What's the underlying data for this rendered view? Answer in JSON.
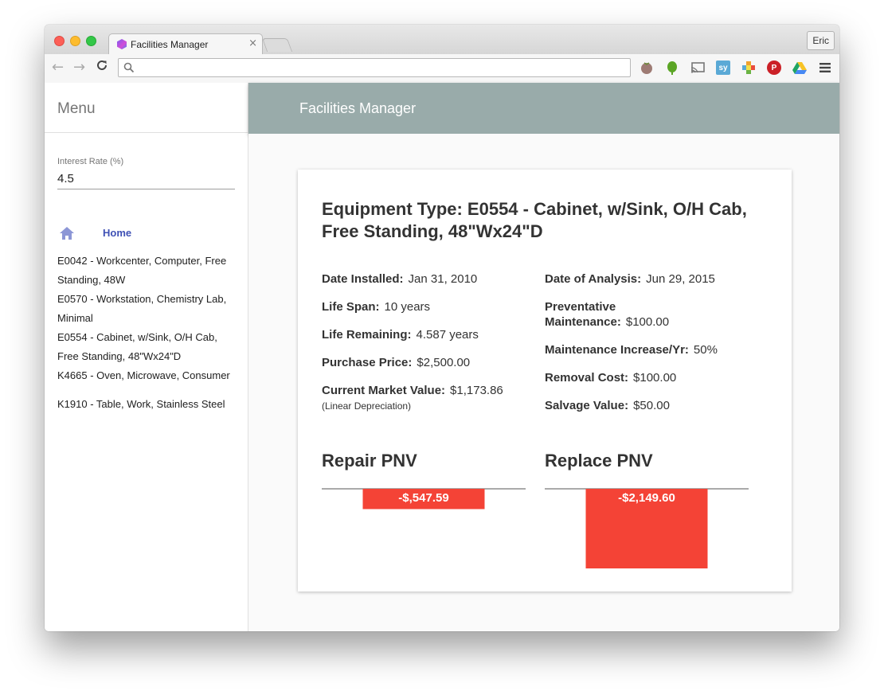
{
  "browser": {
    "tab_title": "Facilities Manager",
    "tab_close": "×",
    "profile": "Eric",
    "url": "",
    "back": "←",
    "forward": "→",
    "reload": "C"
  },
  "extensions": [
    {
      "name": "tomato-icon",
      "color": "#9e7b74",
      "label": ""
    },
    {
      "name": "evernote-icon",
      "color": "#5ba525",
      "label": ""
    },
    {
      "name": "cast-icon",
      "color": "#777777",
      "label": ""
    },
    {
      "name": "sy-icon",
      "color": "#5aa9d6",
      "label": "sy"
    },
    {
      "name": "puzzle-icon",
      "color": "#f0a22e",
      "label": ""
    },
    {
      "name": "pinterest-icon",
      "color": "#cb2027",
      "label": "P"
    },
    {
      "name": "drive-icon",
      "color": "#2fa84f",
      "label": ""
    }
  ],
  "sidebar": {
    "menu_title": "Menu",
    "interest_label": "Interest Rate (%)",
    "interest_value": "4.5",
    "home_label": "Home",
    "items": [
      "E0042 - Workcenter, Computer, Free Standing, 48W",
      "E0570 - Workstation, Chemistry Lab, Minimal",
      "E0554 - Cabinet, w/Sink, O/H Cab, Free Standing, 48\"Wx24\"D",
      "K4665 - Oven, Microwave, Consumer",
      "K1910 - Table, Work, Stainless Steel"
    ]
  },
  "header": {
    "title": "Facilities Manager"
  },
  "card": {
    "title": "Equipment Type: E0554 - Cabinet, w/Sink, O/H Cab, Free Standing, 48\"Wx24\"D",
    "left": {
      "date_installed_label": "Date Installed:",
      "date_installed": "Jan 31, 2010",
      "life_span_label": "Life Span:",
      "life_span": "10 years",
      "life_remaining_label": "Life Remaining:",
      "life_remaining": "4.587 years",
      "purchase_price_label": "Purchase Price:",
      "purchase_price": "$2,500.00",
      "market_value_label": "Current Market Value:",
      "market_value": "$1,173.86",
      "market_value_note": "(Linear Depreciation)"
    },
    "right": {
      "analysis_date_label": "Date of Analysis:",
      "analysis_date": "Jun 29, 2015",
      "pm_label": "Preventative Maintenance:",
      "pm_value": "$100.00",
      "maint_increase_label": "Maintenance Increase/Yr:",
      "maint_increase": "50%",
      "removal_label": "Removal Cost:",
      "removal": "$100.00",
      "salvage_label": "Salvage Value:",
      "salvage": "$50.00"
    },
    "repair_title": "Repair PNV",
    "replace_title": "Replace PNV"
  },
  "chart_data": [
    {
      "type": "bar",
      "title": "Repair PNV",
      "categories": [
        ""
      ],
      "values": [
        -547.59
      ],
      "labels": [
        "-$,547.59"
      ],
      "color": "#f44336",
      "ylim": [
        -2149.6,
        0
      ]
    },
    {
      "type": "bar",
      "title": "Replace PNV",
      "categories": [
        ""
      ],
      "values": [
        -2149.6
      ],
      "labels": [
        "-$2,149.60"
      ],
      "color": "#f44336",
      "ylim": [
        -2149.6,
        0
      ]
    }
  ]
}
